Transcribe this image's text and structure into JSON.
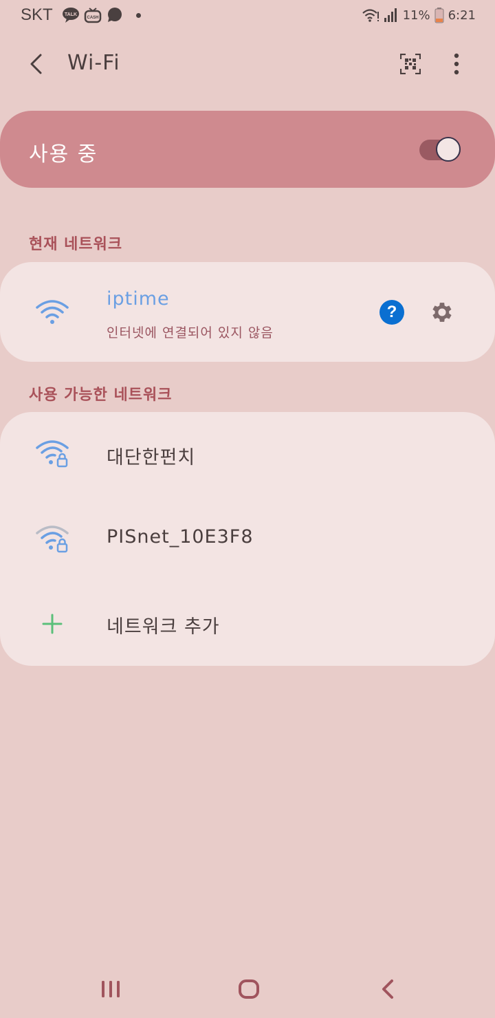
{
  "status_bar": {
    "carrier": "SKT",
    "battery": "11%",
    "time": "6:21"
  },
  "app_bar": {
    "title": "Wi-Fi"
  },
  "master": {
    "label": "사용 중",
    "enabled": true
  },
  "current_section": {
    "header": "현재 네트워크",
    "network": {
      "name": "iptime",
      "status": "인터넷에 연결되어 있지 않음"
    }
  },
  "available_section": {
    "header": "사용 가능한 네트워크",
    "networks": [
      {
        "name": "대단한펀치",
        "locked": true,
        "signal_color": "#6a9fe3"
      },
      {
        "name": "PISnet_10E3F8",
        "locked": true,
        "signal_color": "#b9bcc6"
      }
    ],
    "add_label": "네트워크 추가"
  },
  "colors": {
    "background": "#e8ccc9",
    "master_card": "#cf8a8f",
    "card": "#f3e4e3",
    "accent_blue": "#6a9fe3",
    "section_header": "#a95159",
    "help_blue": "#0a6fd1",
    "add_green": "#5bbf7a"
  }
}
